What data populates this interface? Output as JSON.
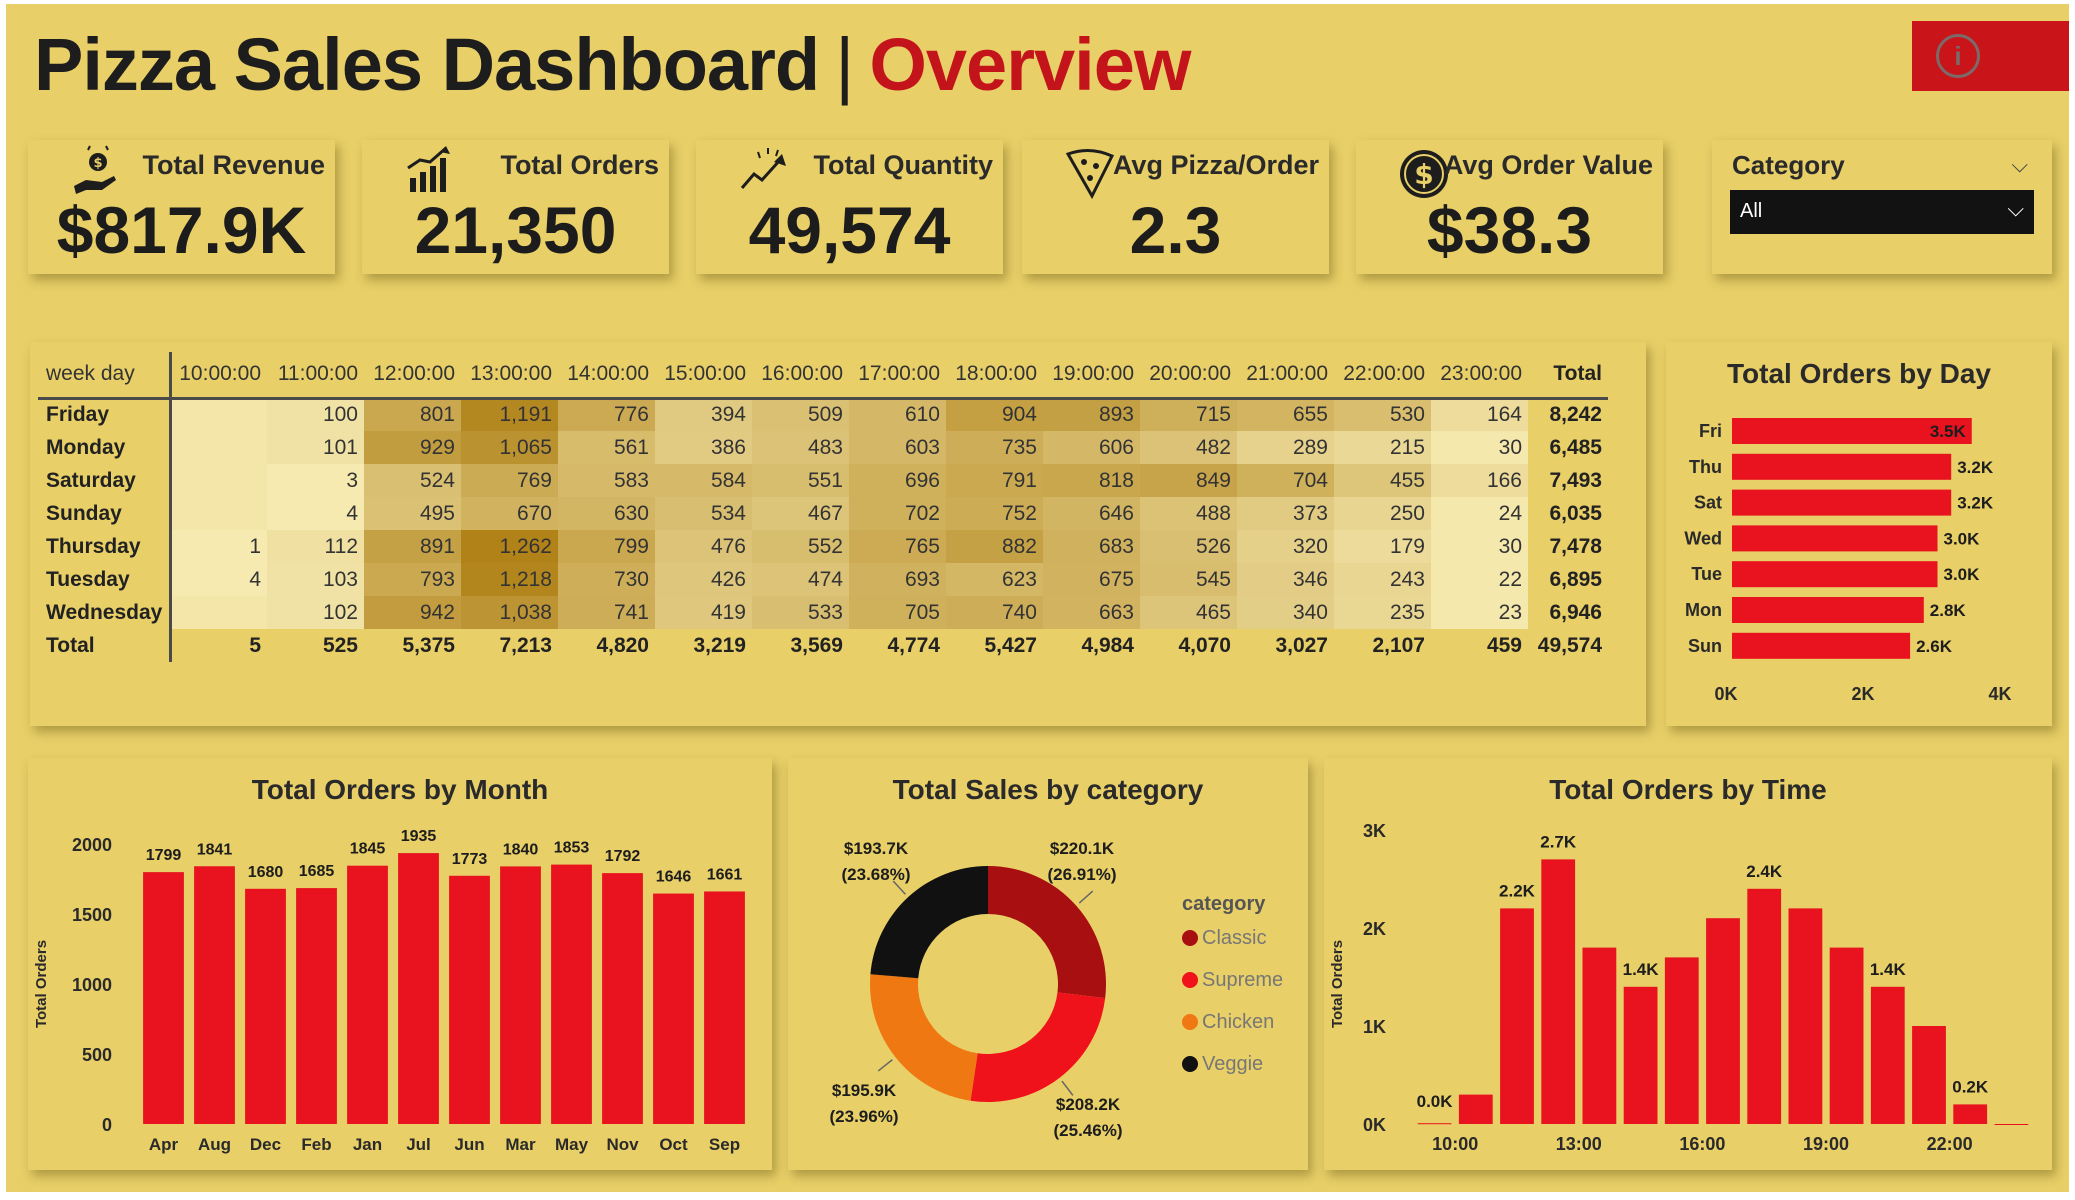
{
  "header": {
    "title_main": "Pizza Sales Dashboard",
    "title_separator": "|",
    "title_accent": "Overview",
    "info_glyph": "i"
  },
  "colors": {
    "background": "#e8cf67",
    "accent_red": "#e8131f",
    "title_red": "#c4141b",
    "dark": "#1d1d1d"
  },
  "kpis": [
    {
      "label": "Total Revenue",
      "value": "$817.9K",
      "icon": "money-hand-icon"
    },
    {
      "label": "Total Orders",
      "value": "21,350",
      "icon": "bar-growth-icon"
    },
    {
      "label": "Total Quantity",
      "value": "49,574",
      "icon": "trend-up-icon"
    },
    {
      "label": "Avg Pizza/Order",
      "value": "2.3",
      "icon": "pizza-slice-icon"
    },
    {
      "label": "Avg Order Value",
      "value": "$38.3",
      "icon": "dollar-coin-icon"
    }
  ],
  "slicer": {
    "label": "Category",
    "selected": "All",
    "chevron_top": "⌵",
    "chevron_dd": "⌵"
  },
  "matrix": {
    "corner_label": "week day",
    "columns": [
      "10:00:00",
      "11:00:00",
      "12:00:00",
      "13:00:00",
      "14:00:00",
      "15:00:00",
      "16:00:00",
      "17:00:00",
      "18:00:00",
      "19:00:00",
      "20:00:00",
      "21:00:00",
      "22:00:00",
      "23:00:00"
    ],
    "total_label": "Total",
    "rows": [
      {
        "day": "Friday",
        "values": [
          "",
          "100",
          "801",
          "1,191",
          "776",
          "394",
          "509",
          "610",
          "904",
          "893",
          "715",
          "655",
          "530",
          "164"
        ],
        "total": "8,242"
      },
      {
        "day": "Monday",
        "values": [
          "",
          "101",
          "929",
          "1,065",
          "561",
          "386",
          "483",
          "603",
          "735",
          "606",
          "482",
          "289",
          "215",
          "30"
        ],
        "total": "6,485"
      },
      {
        "day": "Saturday",
        "values": [
          "",
          "3",
          "524",
          "769",
          "583",
          "584",
          "551",
          "696",
          "791",
          "818",
          "849",
          "704",
          "455",
          "166"
        ],
        "total": "7,493"
      },
      {
        "day": "Sunday",
        "values": [
          "",
          "4",
          "495",
          "670",
          "630",
          "534",
          "467",
          "702",
          "752",
          "646",
          "488",
          "373",
          "250",
          "24"
        ],
        "total": "6,035"
      },
      {
        "day": "Thursday",
        "values": [
          "1",
          "112",
          "891",
          "1,262",
          "799",
          "476",
          "552",
          "765",
          "882",
          "683",
          "526",
          "320",
          "179",
          "30"
        ],
        "total": "7,478"
      },
      {
        "day": "Tuesday",
        "values": [
          "4",
          "103",
          "793",
          "1,218",
          "730",
          "426",
          "474",
          "693",
          "623",
          "675",
          "545",
          "346",
          "243",
          "22"
        ],
        "total": "6,895"
      },
      {
        "day": "Wednesday",
        "values": [
          "",
          "102",
          "942",
          "1,038",
          "741",
          "419",
          "533",
          "705",
          "740",
          "663",
          "465",
          "340",
          "235",
          "23"
        ],
        "total": "6,946"
      }
    ],
    "totals_row_label": "Total",
    "totals": [
      "5",
      "525",
      "5,375",
      "7,213",
      "4,820",
      "3,219",
      "3,569",
      "4,774",
      "5,427",
      "4,984",
      "4,070",
      "3,027",
      "2,107",
      "459"
    ],
    "grand_total": "49,574"
  },
  "chart_data": [
    {
      "type": "bar",
      "orientation": "horizontal",
      "title": "Total Orders by Day",
      "categories": [
        "Fri",
        "Thu",
        "Sat",
        "Wed",
        "Tue",
        "Mon",
        "Sun"
      ],
      "values": [
        3500,
        3200,
        3200,
        3000,
        3000,
        2800,
        2600
      ],
      "data_labels": [
        "3.5K",
        "3.2K",
        "3.2K",
        "3.0K",
        "3.0K",
        "2.8K",
        "2.6K"
      ],
      "xlim": [
        0,
        4000
      ],
      "x_ticks": [
        "0K",
        "2K",
        "4K"
      ],
      "xlabel": "",
      "ylabel": ""
    },
    {
      "type": "bar",
      "title": "Total Orders by Month",
      "categories": [
        "Apr",
        "Aug",
        "Dec",
        "Feb",
        "Jan",
        "Jul",
        "Jun",
        "Mar",
        "May",
        "Nov",
        "Oct",
        "Sep"
      ],
      "values": [
        1799,
        1841,
        1680,
        1685,
        1845,
        1935,
        1773,
        1840,
        1853,
        1792,
        1646,
        1661
      ],
      "ylim": [
        0,
        2000
      ],
      "y_ticks": [
        "0",
        "500",
        "1000",
        "1500",
        "2000"
      ],
      "ylabel": "Total Orders",
      "xlabel": ""
    },
    {
      "type": "pie",
      "style": "donut",
      "title": "Total Sales by category",
      "legend_title": "category",
      "legend_position": "right",
      "slices": [
        {
          "name": "Classic",
          "value": 220.1,
          "label": "$220.1K",
          "pct": "(26.91%)",
          "color": "#a80f10"
        },
        {
          "name": "Supreme",
          "value": 208.2,
          "label": "$208.2K",
          "pct": "(25.46%)",
          "color": "#f0121a"
        },
        {
          "name": "Chicken",
          "value": 195.9,
          "label": "$195.9K",
          "pct": "(23.96%)",
          "color": "#f07812"
        },
        {
          "name": "Veggie",
          "value": 193.7,
          "label": "$193.7K",
          "pct": "(23.68%)",
          "color": "#111111"
        }
      ]
    },
    {
      "type": "bar",
      "title": "Total Orders by Time",
      "x": [
        9,
        10,
        11,
        12,
        13,
        14,
        15,
        16,
        17,
        18,
        19,
        20,
        21,
        22,
        23
      ],
      "values": [
        8,
        300,
        2200,
        2700,
        1800,
        1400,
        1700,
        2100,
        2400,
        2200,
        1800,
        1400,
        1000,
        200,
        0
      ],
      "data_labels": [
        "",
        "",
        "2.2K",
        "2.7K",
        "",
        "1.4K",
        "",
        "",
        "2.4K",
        "",
        "",
        "1.4K",
        "",
        "0.2K",
        ""
      ],
      "extra_labels": [
        "0.0K"
      ],
      "x_ticks": [
        "10:00",
        "13:00",
        "16:00",
        "19:00",
        "22:00"
      ],
      "y_ticks": [
        "0K",
        "1K",
        "2K",
        "3K"
      ],
      "ylim": [
        0,
        3000
      ],
      "ylabel": "Total Orders",
      "xlabel": ""
    }
  ]
}
